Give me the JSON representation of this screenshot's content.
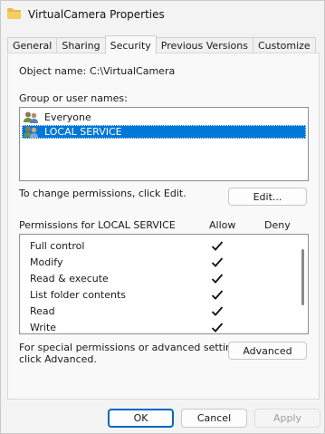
{
  "window": {
    "title": "VirtualCamera Properties",
    "icon": "folder-icon"
  },
  "tabs": [
    {
      "label": "General"
    },
    {
      "label": "Sharing"
    },
    {
      "label": "Security"
    },
    {
      "label": "Previous Versions"
    },
    {
      "label": "Customize"
    }
  ],
  "security": {
    "object_name_label": "Object name:",
    "object_name_value": "C:\\VirtualCamera",
    "group_label": "Group or user names:",
    "groups": [
      {
        "name": "Everyone",
        "icon": "users-icon"
      },
      {
        "name": "LOCAL SERVICE",
        "icon": "users-icon",
        "selected": true
      }
    ],
    "change_text": "To change permissions, click Edit.",
    "edit_button": "Edit...",
    "permissions_title": "Permissions for LOCAL SERVICE",
    "allow_header": "Allow",
    "deny_header": "Deny",
    "permissions": [
      {
        "name": "Full control",
        "allow": true,
        "deny": false
      },
      {
        "name": "Modify",
        "allow": true,
        "deny": false
      },
      {
        "name": "Read & execute",
        "allow": true,
        "deny": false
      },
      {
        "name": "List folder contents",
        "allow": true,
        "deny": false
      },
      {
        "name": "Read",
        "allow": true,
        "deny": false
      },
      {
        "name": "Write",
        "allow": true,
        "deny": false
      }
    ],
    "special_text_line1": "For special permissions or advanced settings,",
    "special_text_line2": "click Advanced.",
    "advanced_button": "Advanced"
  },
  "footer": {
    "ok": "OK",
    "cancel": "Cancel",
    "apply": "Apply"
  },
  "colors": {
    "selection": "#0078d7",
    "accent": "#0067c0"
  }
}
